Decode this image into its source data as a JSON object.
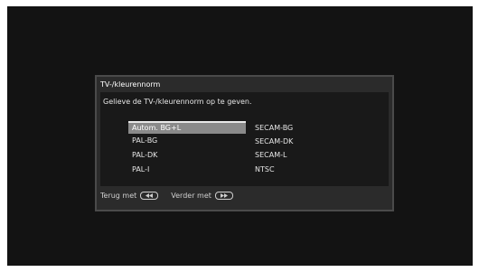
{
  "dialog": {
    "title": "TV-/kleurennorm",
    "prompt": "Gelieve de TV-/kleurennorm op te geven.",
    "options_left": [
      "Autom. BG+L",
      "PAL-BG",
      "PAL-DK",
      "PAL-I"
    ],
    "options_right": [
      "SECAM-BG",
      "SECAM-DK",
      "SECAM-L",
      "NTSC"
    ],
    "selected": "Autom. BG+L",
    "footer": {
      "back_label": "Terug met",
      "next_label": "Verder met",
      "back_icon": "rewind-button-icon",
      "next_icon": "forward-button-icon"
    }
  },
  "colors": {
    "screen": "#131313",
    "dialog": "#2b2b2b",
    "body": "#191919",
    "highlight": "#8a8a8a"
  }
}
